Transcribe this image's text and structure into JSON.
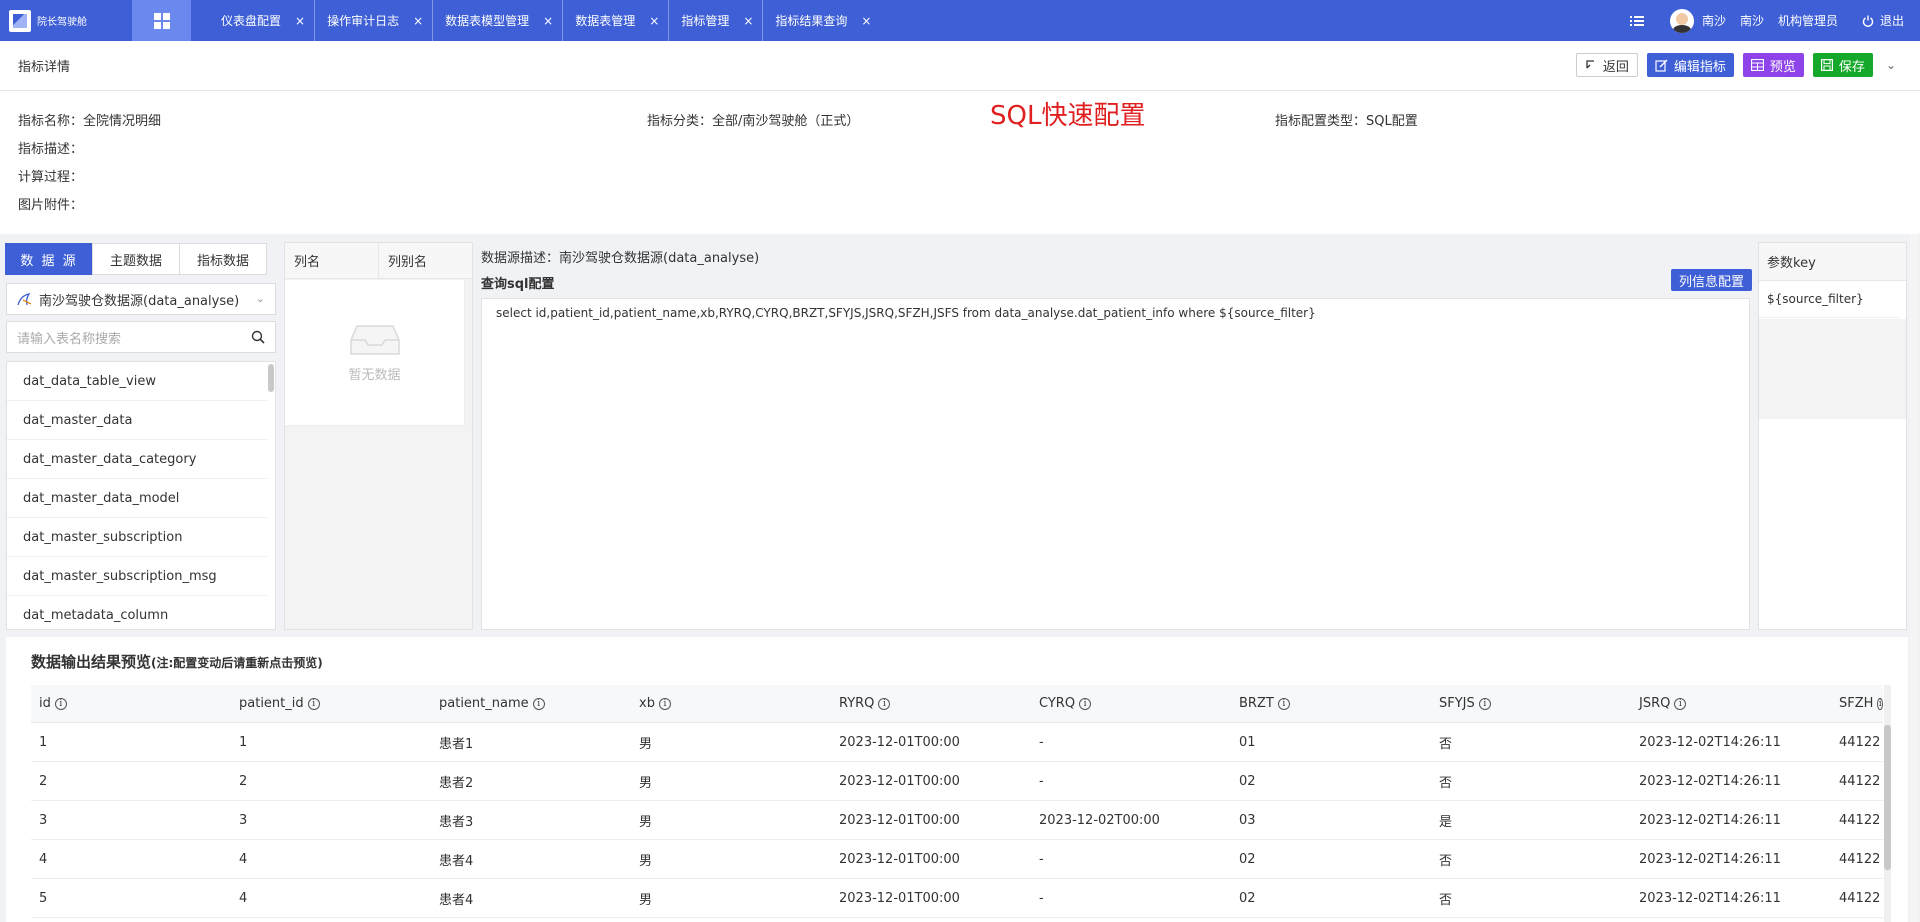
{
  "topbar": {
    "logo_text": "院长驾驶舱",
    "tabs": [
      {
        "label": "仪表盘配置"
      },
      {
        "label": "操作审计日志"
      },
      {
        "label": "数据表模型管理"
      },
      {
        "label": "数据表管理"
      },
      {
        "label": "指标管理"
      },
      {
        "label": "指标结果查询"
      }
    ],
    "close_glyph": "×",
    "user_name": "南沙",
    "org": "南沙",
    "role": "机构管理员",
    "logout": "退出"
  },
  "header": {
    "title": "指标详情",
    "back": "返回",
    "edit": "编辑指标",
    "preview": "预览",
    "save": "保存"
  },
  "info": {
    "name_label": "指标名称：全院情况明细",
    "category_label": "指标分类：全部/南沙驾驶舱（正式）",
    "config_type_label": "指标配置类型：SQL配置",
    "desc_label": "指标描述：",
    "calc_label": "计算过程：",
    "attach_label": "图片附件：",
    "section_title": "SQL快速配置"
  },
  "source": {
    "tabs": [
      "数 据 源",
      "主题数据",
      "指标数据"
    ],
    "selected_source": "南沙驾驶仓数据源(data_analyse)",
    "search_placeholder": "请输入表名称搜索",
    "tables": [
      "dat_data_table_view",
      "dat_master_data",
      "dat_master_data_category",
      "dat_master_data_model",
      "dat_master_subscription",
      "dat_master_subscription_msg",
      "dat_metadata_column"
    ]
  },
  "columns": {
    "col_name": "列名",
    "col_alias": "列别名",
    "empty_text": "暂无数据"
  },
  "sql": {
    "ds_desc": "数据源描述：南沙驾驶仓数据源(data_analyse)",
    "label": "查询sql配置",
    "col_info_button": "列信息配置",
    "query": "select id,patient_id,patient_name,xb,RYRQ,CYRQ,BRZT,SFYJS,JSRQ,SFZH,JSFS from data_analyse.dat_patient_info  where   ${source_filter}"
  },
  "params": {
    "header": "参数key",
    "items": [
      "${source_filter}"
    ]
  },
  "preview": {
    "title": "数据输出结果预览",
    "note": "(注:配置变动后请重新点击预览)",
    "columns": [
      "id",
      "patient_id",
      "patient_name",
      "xb",
      "RYRQ",
      "CYRQ",
      "BRZT",
      "SFYJS",
      "JSRQ",
      "SFZH"
    ],
    "rows": [
      [
        "1",
        "1",
        "患者1",
        "男",
        "2023-12-01T00:00",
        "-",
        "01",
        "否",
        "2023-12-02T14:26:11",
        "44122"
      ],
      [
        "2",
        "2",
        "患者2",
        "男",
        "2023-12-01T00:00",
        "-",
        "02",
        "否",
        "2023-12-02T14:26:11",
        "44122"
      ],
      [
        "3",
        "3",
        "患者3",
        "男",
        "2023-12-01T00:00",
        "2023-12-02T00:00",
        "03",
        "是",
        "2023-12-02T14:26:11",
        "44122"
      ],
      [
        "4",
        "4",
        "患者4",
        "男",
        "2023-12-01T00:00",
        "-",
        "02",
        "否",
        "2023-12-02T14:26:11",
        "44122"
      ],
      [
        "5",
        "4",
        "患者4",
        "男",
        "2023-12-01T00:00",
        "-",
        "02",
        "否",
        "2023-12-02T14:26:11",
        "44122"
      ]
    ]
  }
}
